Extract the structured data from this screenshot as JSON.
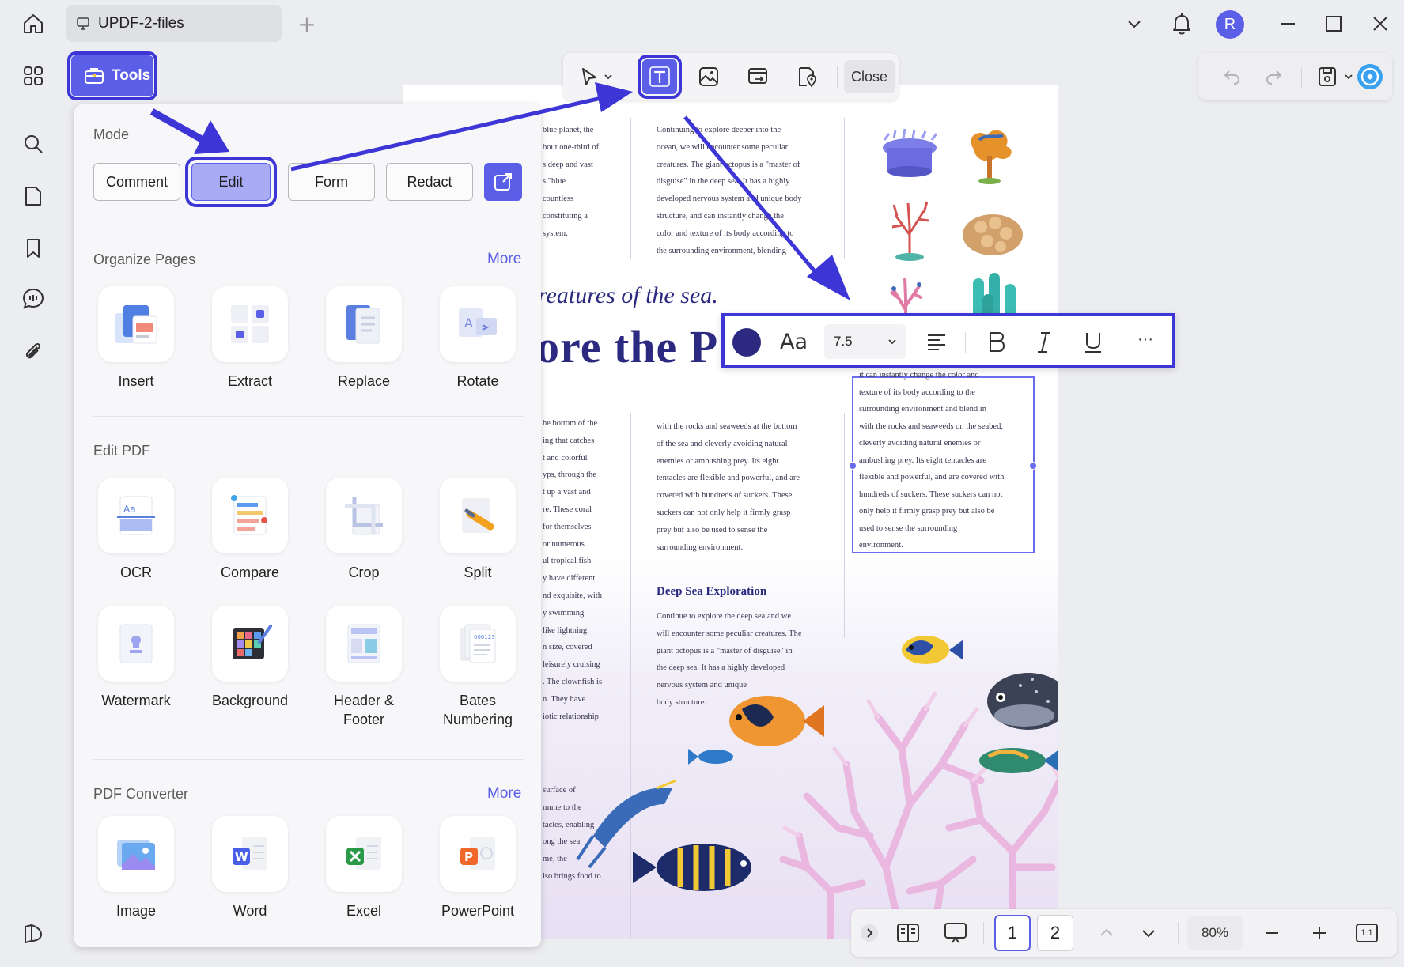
{
  "titlebar": {
    "tab_title": "UPDF-2-files",
    "new_tab": "+",
    "avatar_initial": "R",
    "icons": [
      "home-icon",
      "monitor-icon",
      "chevron-down-icon",
      "bell-icon",
      "minimize-icon",
      "maximize-icon",
      "close-icon"
    ]
  },
  "left_rail": {
    "icons": [
      "apps-grid-icon",
      "search-icon",
      "page-icon",
      "bookmark-icon",
      "comment-icon",
      "attachment-icon",
      "layers-icon"
    ]
  },
  "edit_toolbar": {
    "icons": [
      "cursor-icon",
      "chevron-down-icon",
      "text-icon",
      "image-icon",
      "link-icon",
      "location-icon"
    ],
    "close_label": "Close"
  },
  "right_tools": {
    "icons": [
      "undo-icon",
      "redo-icon",
      "save-icon",
      "chevron-down-icon",
      "ai-assistant-icon"
    ]
  },
  "tools_button": {
    "label": "Tools"
  },
  "tools_panel": {
    "mode": {
      "title": "Mode",
      "buttons": [
        "Comment",
        "Edit",
        "Form",
        "Redact"
      ],
      "selected": "Edit"
    },
    "organize": {
      "title": "Organize Pages",
      "more": "More",
      "items": [
        "Insert",
        "Extract",
        "Replace",
        "Rotate"
      ]
    },
    "edit_pdf": {
      "title": "Edit PDF",
      "items": [
        "OCR",
        "Compare",
        "Crop",
        "Split",
        "Watermark",
        "Background",
        "Header &\nFooter",
        "Bates\nNumbering"
      ]
    },
    "converter": {
      "title": "PDF Converter",
      "more": "More",
      "items": [
        "Image",
        "Word",
        "Excel",
        "PowerPoint"
      ]
    }
  },
  "format_bar": {
    "font_label": "Aa",
    "font_size": "7.5",
    "color": "#2b2a80",
    "more": "···"
  },
  "document": {
    "left_col_top": [
      "blue planet, the",
      "bout one-third of",
      "s deep and vast",
      "s \"blue",
      "countless",
      "constituting a",
      "system."
    ],
    "mid_col_top": [
      "Continuing to explore deeper into the",
      "ocean, we will encounter some peculiar",
      "creatures. The giant octopus is a \"master of",
      "disguise\" in the deep sea. It has a highly",
      "developed nervous system and unique body",
      "structure, and can instantly change the",
      "color and texture of its body according to",
      "the surrounding environment, blending"
    ],
    "heading_italic": "reatures of the sea.",
    "heading_big": "ore the P",
    "textbox": [
      "it can instantly change the color and",
      "texture of its body according to the",
      "surrounding environment and blend in",
      "with the rocks and seaweeds on the seabed,",
      "cleverly avoiding natural enemies or",
      "ambushing prey. Its eight tentacles are",
      "flexible and powerful, and are covered with",
      "hundreds of suckers. These suckers can not",
      "only help it firmly grasp prey but also be",
      "used to sense the surrounding",
      "environment."
    ],
    "left_col_mid": [
      "he bottom of the",
      "ing that catches",
      "t and colorful",
      "yps, through the",
      "t up a vast and",
      "re. These coral",
      "for themselves",
      "or numerous",
      "ul tropical fish",
      "y have different",
      "nd exquisite, with",
      "y swimming",
      "like lightning.",
      "n size, covered",
      "leisurely cruising",
      ". The clownfish is",
      "n. They have",
      "iotic relationship"
    ],
    "mid_col_mid": [
      "with the rocks and seaweeds at the bottom",
      "of the sea and cleverly avoiding natural",
      "enemies or ambushing prey. Its eight",
      "tentacles are flexible and powerful, and are",
      "covered with hundreds of suckers. These",
      "suckers can not only help it firmly grasp",
      "prey but also be used to sense the",
      "surrounding environment."
    ],
    "deep_sea_heading": "Deep Sea Exploration",
    "deep_sea_text": [
      "Continue to explore the deep sea and we",
      "will encounter some peculiar creatures. The",
      "giant octopus is a \"master of disguise\" in",
      "the deep sea. It has a highly developed",
      "nervous system and unique",
      "body structure."
    ],
    "left_col_bottom": [
      "surface of",
      "mune to the",
      "tacles, enabling",
      "ong the sea",
      "me, the",
      "lso brings food to"
    ]
  },
  "bottom_bar": {
    "pages": [
      "1",
      "2"
    ],
    "current_page": "1",
    "zoom": "80%",
    "fit_label": "1:1",
    "icons": [
      "expand-icon",
      "two-page-icon",
      "presentation-icon",
      "chevron-up-icon",
      "chevron-down-icon",
      "zoom-out-icon",
      "zoom-in-icon",
      "actual-size-icon"
    ]
  },
  "colors": {
    "accent": "#5b5fe8",
    "highlight": "#3d35d6",
    "heading": "#2b2a80"
  }
}
